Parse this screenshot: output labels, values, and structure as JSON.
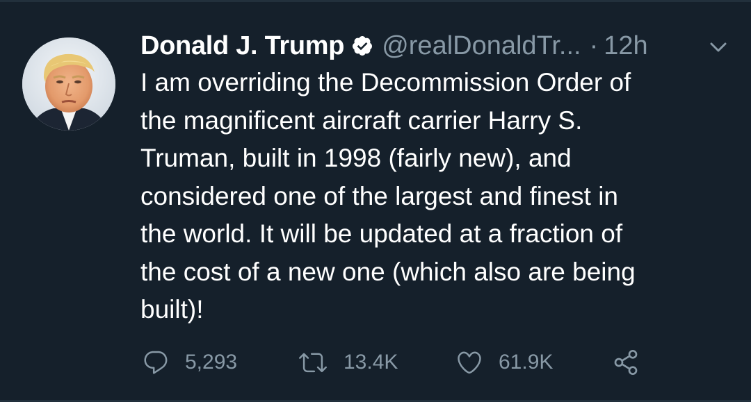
{
  "tweet": {
    "display_name": "Donald J. Trump",
    "handle": "@realDonaldTr...",
    "separator": "·",
    "time": "12h",
    "text": "I am overriding the Decommission Order of\nthe magnificent aircraft carrier Harry S.\nTruman, built in 1998 (fairly new), and\nconsidered one of the largest and finest in\nthe world. It will be updated at a fraction of\nthe cost of a new one (which also are being\nbuilt)!",
    "verified": true
  },
  "actions": {
    "replies": "5,293",
    "retweets": "13.4K",
    "likes": "61.9K"
  },
  "icons": {
    "verified": "verified-badge-icon",
    "caret": "chevron-down-icon",
    "reply": "reply-bubble-icon",
    "retweet": "retweet-icon",
    "like": "heart-icon",
    "share": "share-icon"
  },
  "colors": {
    "background": "#15202b",
    "primary_text": "#ffffff",
    "secondary_text": "#8899a6",
    "divider": "#22303c"
  }
}
